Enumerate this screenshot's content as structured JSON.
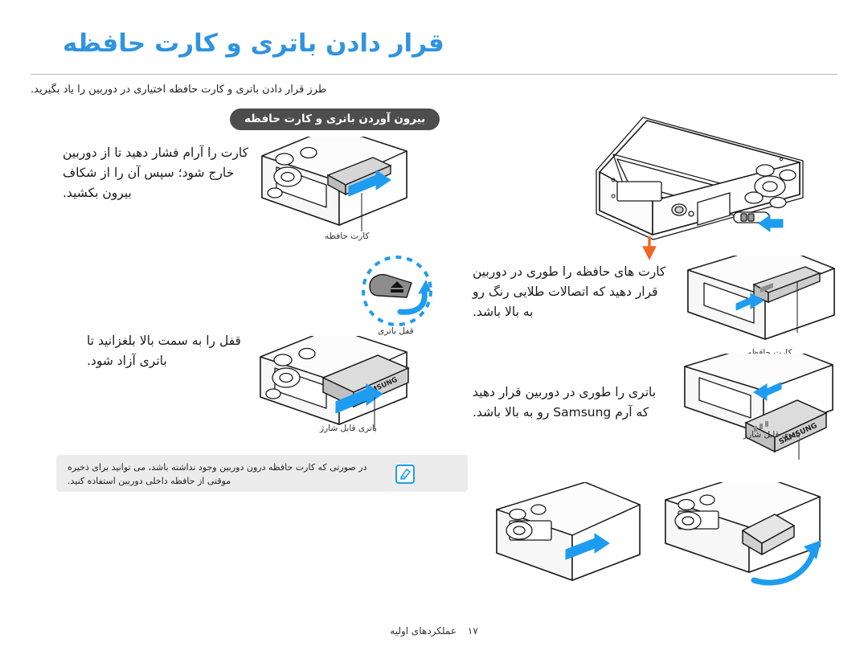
{
  "document": {
    "title": "قرار دادن باتری و کارت حافظه",
    "intro": "طرز قرار دادن باتری و کارت حافظه اختیاری در دوربین را یاد بگیرید.",
    "section_label": "بیرون آوردن باتری و کارت حافظه",
    "footer_section": "عملکردهای اولیه",
    "footer_page": "۱۷"
  },
  "colors": {
    "title": "#2f93e0",
    "pill_bg": "#4d4d4d",
    "pill_text": "#ffffff",
    "note_bg": "#ececec",
    "accent_blue": "#1e9cf0",
    "accent_orange": "#f26522",
    "line": "#b9b9b9",
    "device_fill": "#f2f2f2",
    "device_stroke": "#1a1a1a",
    "screen_fill": "#ffffff",
    "card_fill": "#d9d9d9",
    "battery_fill": "#cfcfcf"
  },
  "left_column": {
    "steps": [
      {
        "id": "remove-card",
        "text": "کارت را آرام فشار دهید تا از دوربین خارج شود؛ سپس آن را از شکاف بیرون بکشید."
      },
      {
        "id": "release-battery",
        "text": "قفل را به سمت بالا بلغزانید تا باتری آزاد شود."
      }
    ],
    "captions": [
      {
        "id": "memory-card",
        "text": "کارت حافظه"
      },
      {
        "id": "battery-lock",
        "text": "قفل باتری"
      },
      {
        "id": "rechargeable-battery",
        "text": "باتری قابل شارژ"
      }
    ]
  },
  "right_column": {
    "steps": [
      {
        "id": "insert-card",
        "text": "کارت های حافظه را طوری در دوربین قرار دهید که اتصالات طلایی رنگ رو به بالا باشد."
      },
      {
        "id": "insert-battery",
        "text": "باتری را طوری در دوربین قرار دهید که آرم Samsung رو به بالا باشد."
      }
    ],
    "captions": [
      {
        "id": "memory-card",
        "text": "کارت حافظه"
      },
      {
        "id": "rechargeable-battery",
        "text": "باتری قابل شارژ"
      }
    ],
    "battery_brand": "SAMSUNG"
  },
  "note": {
    "icon": "note-pen-icon",
    "text": "در صورتی که کارت حافظه درون دوربین وجود نداشته باشد، می توانید برای ذخیره موقتی از حافظه داخلی دوربین استفاده کنید."
  }
}
